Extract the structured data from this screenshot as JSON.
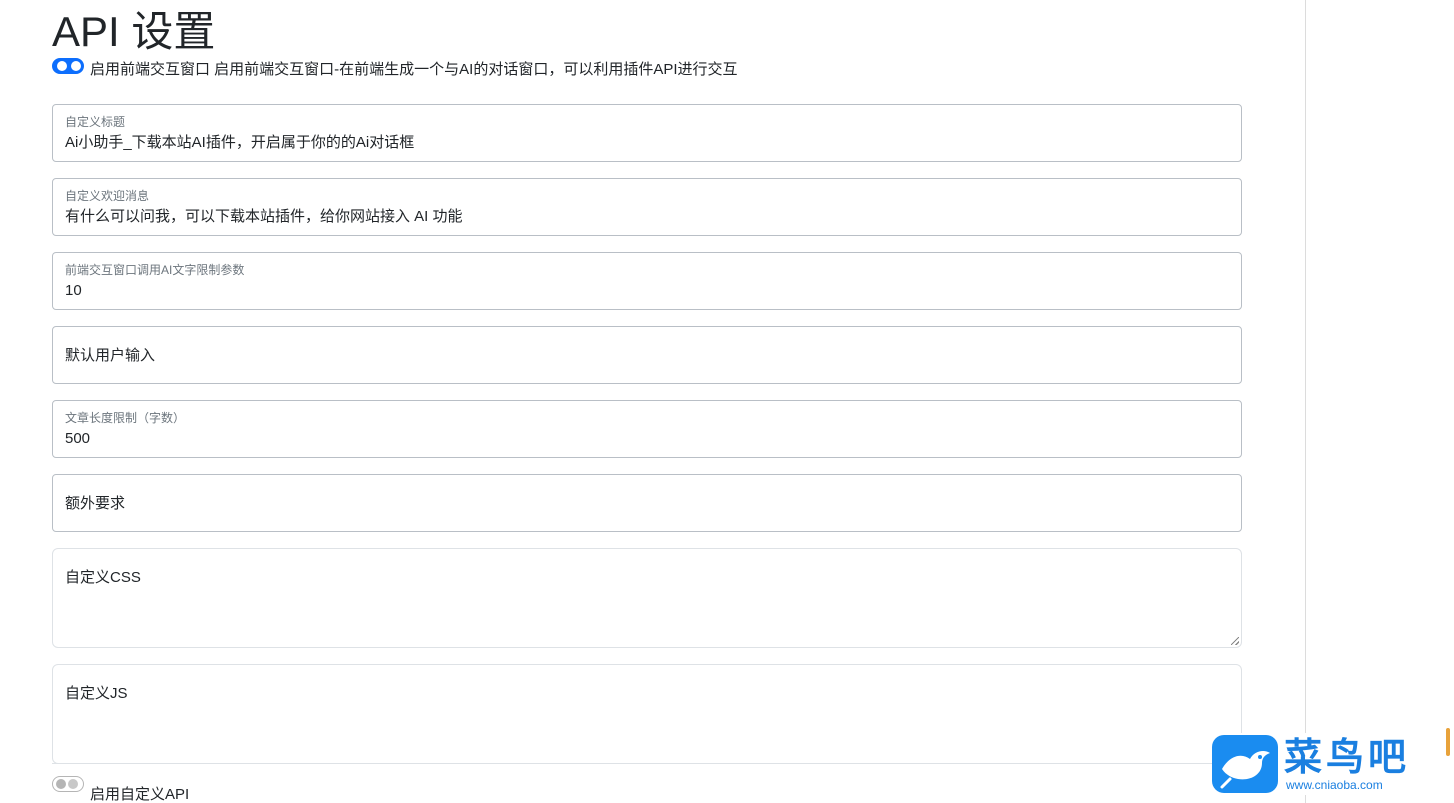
{
  "page": {
    "title": "API 设置"
  },
  "frontend_toggle": {
    "state": "on",
    "label": "启用前端交互窗口 启用前端交互窗口-在前端生成一个与AI的对话窗口，可以利用插件API进行交互"
  },
  "fields": {
    "custom_title": {
      "label": "自定义标题",
      "value": "Ai小助手_下载本站AI插件，开启属于你的的Ai对话框"
    },
    "welcome_message": {
      "label": "自定义欢迎消息",
      "value": "有什么可以问我，可以下载本站插件，给你网站接入 AI 功能"
    },
    "text_limit": {
      "label": "前端交互窗口调用AI文字限制参数",
      "value": "10"
    },
    "default_user_input": {
      "placeholder": "默认用户输入"
    },
    "article_length": {
      "label": "文章长度限制（字数）",
      "value": "500"
    },
    "extra_requirements": {
      "placeholder": "额外要求"
    },
    "custom_css": {
      "placeholder": "自定义CSS"
    },
    "custom_js": {
      "placeholder": "自定义JS"
    }
  },
  "custom_api_toggle": {
    "state": "off",
    "label": "启用自定义API"
  },
  "watermark": {
    "name": "菜鸟吧",
    "url": "www.cniaoba.com"
  },
  "colors": {
    "accent": "#0d6efd",
    "logo_blue": "#1a8cf0"
  }
}
